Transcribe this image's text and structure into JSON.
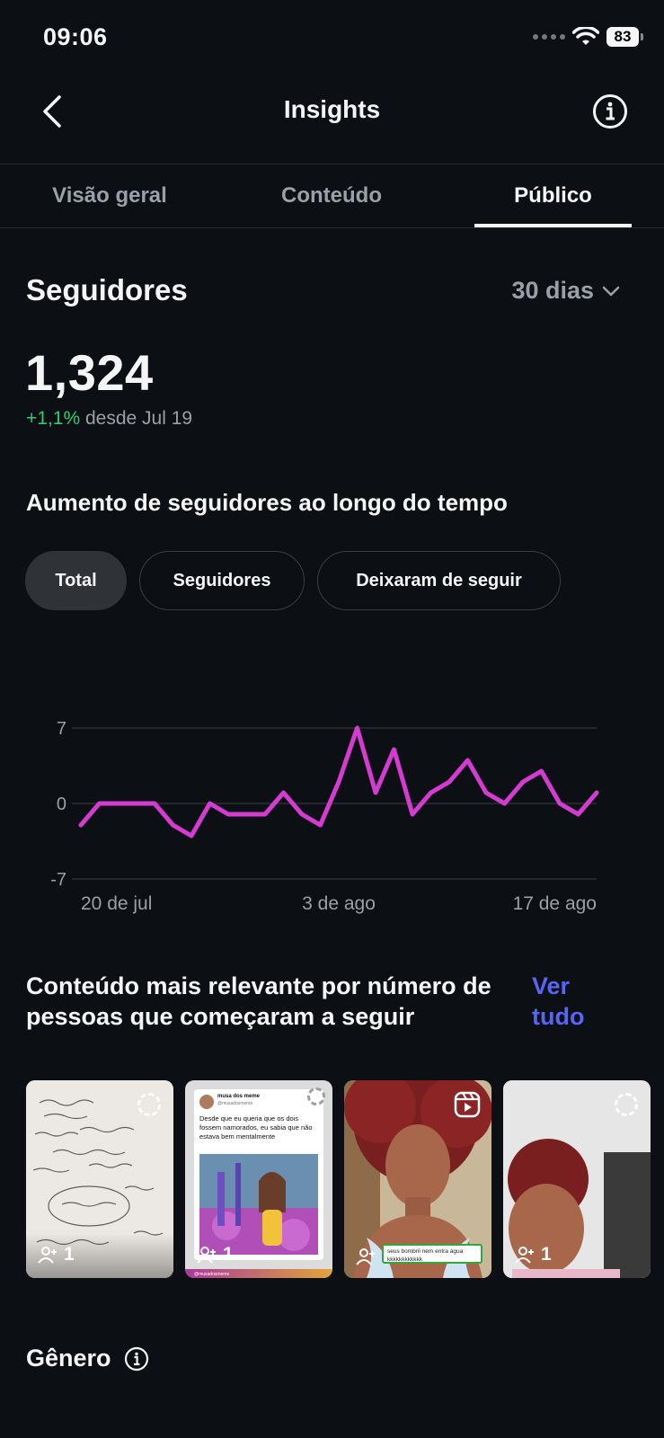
{
  "status_bar": {
    "time": "09:06",
    "battery": "83"
  },
  "header": {
    "title": "Insights"
  },
  "tabs": [
    {
      "label": "Visão geral"
    },
    {
      "label": "Conteúdo"
    },
    {
      "label": "Público"
    }
  ],
  "active_tab": "Público",
  "followers": {
    "title": "Seguidores",
    "period": "30 dias",
    "count": "1,324",
    "change": "+1,1%",
    "change_suffix": "desde Jul 19"
  },
  "growth": {
    "title": "Aumento de seguidores ao longo do tempo",
    "filters": [
      "Total",
      "Seguidores",
      "Deixaram de seguir"
    ],
    "active_filter": "Total"
  },
  "chart_data": {
    "type": "line",
    "x": [
      1,
      2,
      3,
      4,
      5,
      6,
      7,
      8,
      9,
      10,
      11,
      12,
      13,
      14,
      15,
      16,
      17,
      18,
      19,
      20,
      21,
      22,
      23,
      24,
      25,
      26,
      27,
      28,
      29
    ],
    "values": [
      -2,
      0,
      0,
      0,
      0,
      -2,
      -3,
      0,
      -1,
      -1,
      -1,
      1,
      -1,
      -2,
      2,
      7,
      1,
      5,
      -1,
      1,
      2,
      4,
      1,
      0,
      2,
      3,
      0,
      -1,
      1
    ],
    "y_ticks": [
      7,
      0,
      -7
    ],
    "x_tick_labels": [
      "20 de jul",
      "3 de ago",
      "17 de ago"
    ],
    "ylim": [
      -7,
      7
    ],
    "line_color": "#d53bd0",
    "grid": true
  },
  "relevant": {
    "title": "Conteúdo mais relevante por número de pessoas que começaram a seguir",
    "see_all": "Ver tudo",
    "items": [
      {
        "count": "1"
      },
      {
        "count": "1"
      },
      {
        "count": ""
      },
      {
        "count": "1"
      }
    ],
    "thumb_texts": {
      "meme_author": "musa dos meme",
      "meme_handle": "@musadosmeme",
      "meme_text": "Desde que eu queria que os dois fossem namorados, eu sabia que não estava bem mentalmente",
      "meme_footer": "@musadosmeme",
      "caption": "seus bombril nem entra água kkkkkkkkkkkk"
    }
  },
  "gender": {
    "title": "Gênero"
  }
}
